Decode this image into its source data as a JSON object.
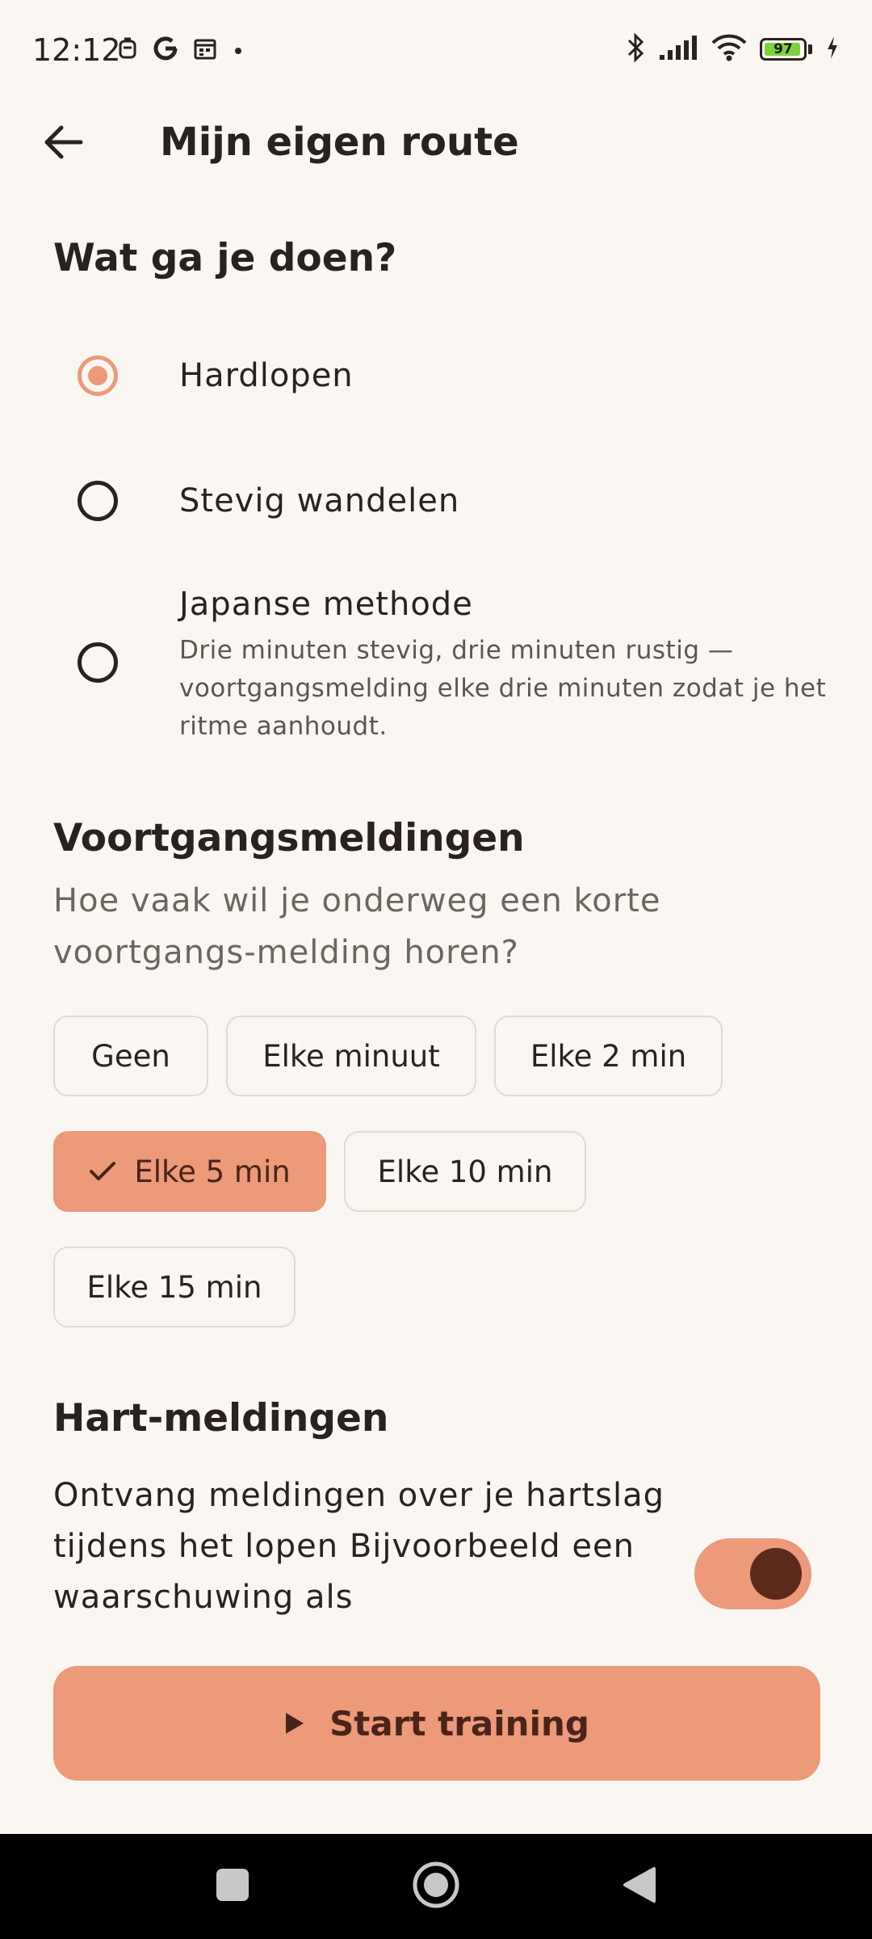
{
  "status_bar": {
    "time": "12:12",
    "battery_level": "97",
    "icons_left": [
      "notification-icon",
      "google-icon",
      "calendar-icon",
      "dot-icon"
    ],
    "icons_right": [
      "bluetooth-icon",
      "signal-icon",
      "wifi-icon",
      "battery-icon",
      "charging-icon"
    ]
  },
  "header": {
    "title": "Mijn eigen route"
  },
  "activity": {
    "title": "Wat ga je doen?",
    "options": [
      {
        "label": "Hardlopen",
        "selected": true
      },
      {
        "label": "Stevig wandelen",
        "selected": false
      },
      {
        "label": "Japanse methode",
        "description": "Drie minuten stevig, drie minuten rustig — voortgangsmelding elke drie minuten zodat je het ritme aanhoudt.",
        "selected": false
      }
    ]
  },
  "progress": {
    "title": "Voortgangsmeldingen",
    "description": "Hoe vaak wil je onderweg een korte voortgangs-melding horen?",
    "chips": [
      {
        "label": "Geen",
        "selected": false
      },
      {
        "label": "Elke minuut",
        "selected": false
      },
      {
        "label": "Elke 2 min",
        "selected": false
      },
      {
        "label": "Elke 5 min",
        "selected": true
      },
      {
        "label": "Elke 10 min",
        "selected": false
      },
      {
        "label": "Elke 15 min",
        "selected": false
      }
    ]
  },
  "heart": {
    "title": "Hart-meldingen",
    "description": "Ontvang meldingen over je hartslag tijdens het lopen Bijvoorbeeld een waarschuwing als",
    "toggle_on": true
  },
  "start_button": {
    "label": "Start training"
  },
  "colors": {
    "accent": "#EC9A7A",
    "background": "#FAF7F2",
    "text": "#2A221E",
    "knob": "#5A2A1A"
  }
}
